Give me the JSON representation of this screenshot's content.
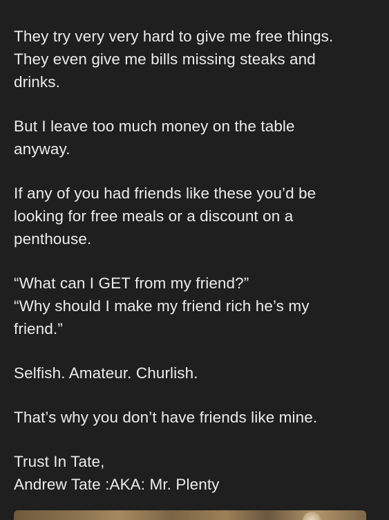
{
  "post": {
    "paragraphs": [
      [
        "They try very very hard to give me free things.",
        "They even give me bills missing steaks and",
        "drinks."
      ],
      [
        "But I leave too much money on the table",
        "anyway."
      ],
      [
        "If any of you had friends like these you’d be",
        "looking for free meals or a discount on a",
        "penthouse."
      ],
      [
        "“What can I GET from my friend?”",
        "“Why should I make my friend rich he’s my",
        "friend.”"
      ],
      [
        "Selfish. Amateur. Churlish."
      ],
      [
        "That’s why you don’t have friends like mine."
      ],
      [
        "Trust In Tate,",
        "Andrew Tate :AKA: Mr. Plenty"
      ]
    ]
  },
  "colors": {
    "background": "#1f1f1f",
    "text": "#ececec"
  }
}
